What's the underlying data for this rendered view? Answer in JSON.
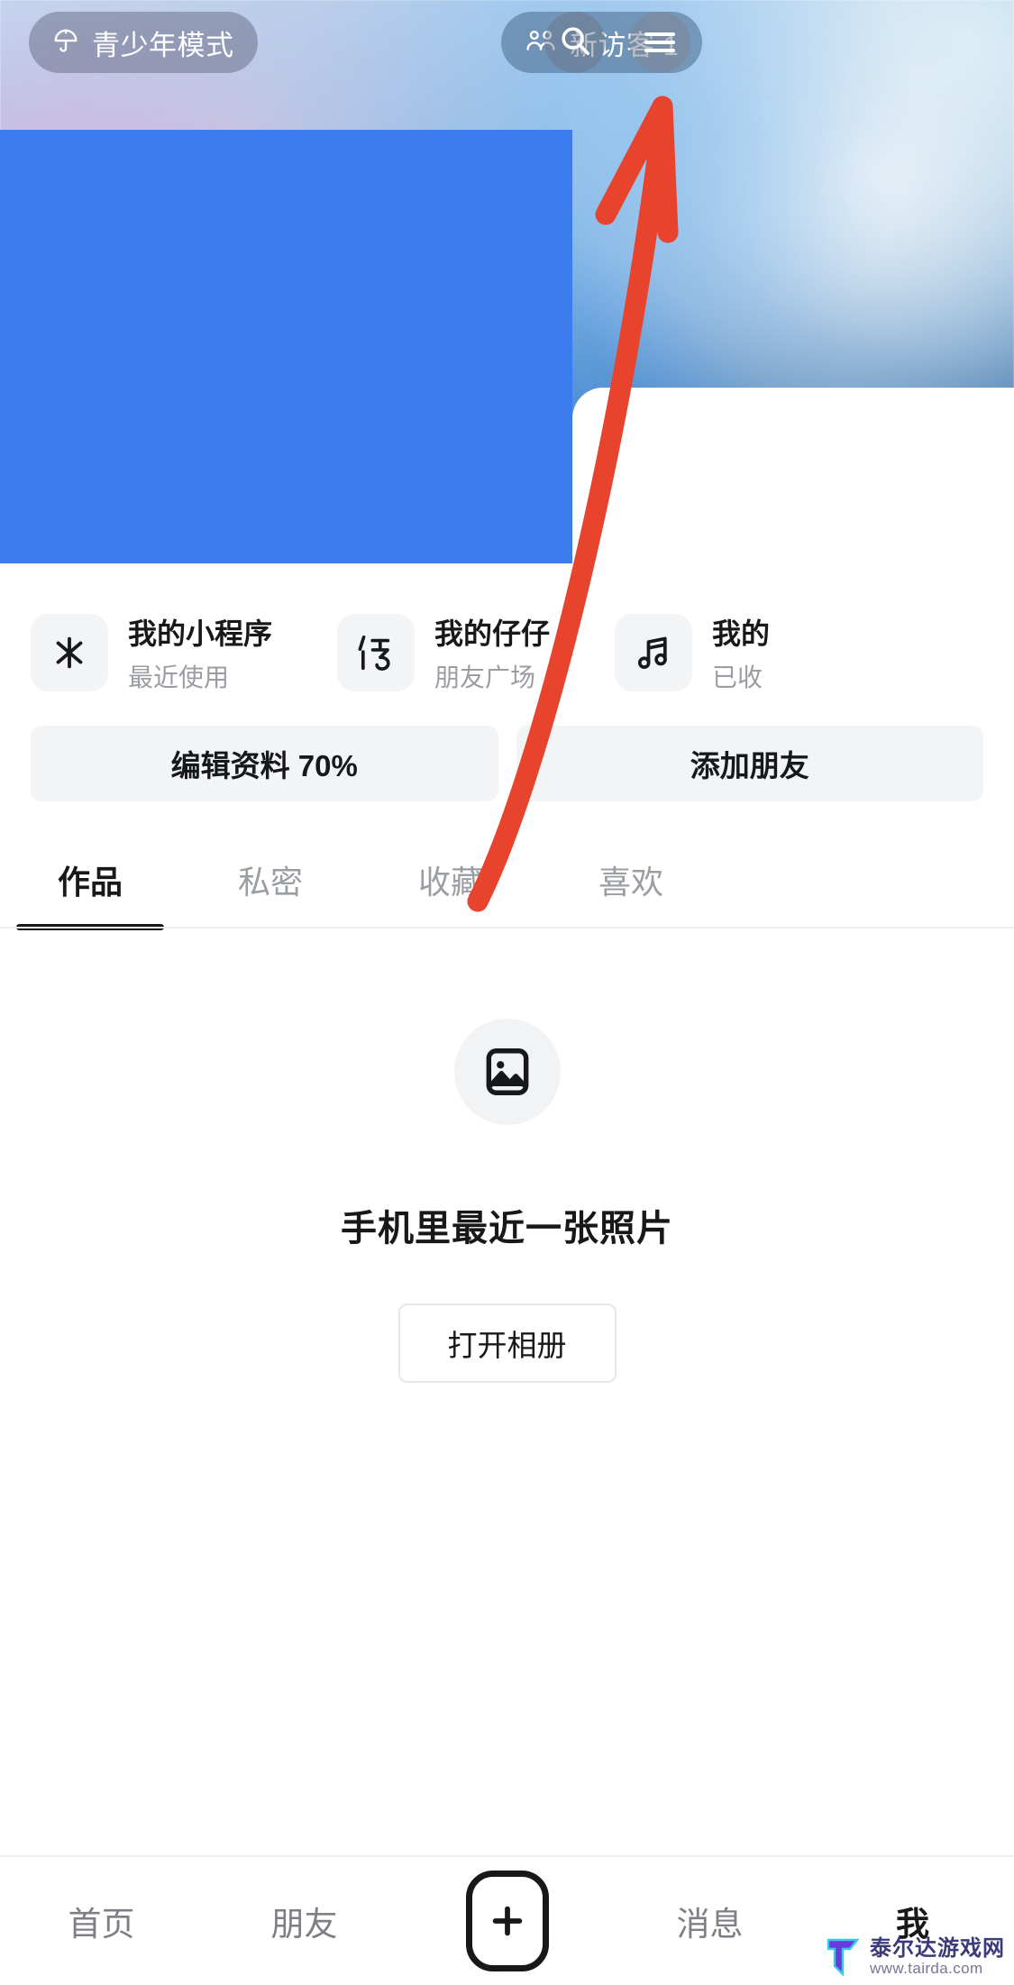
{
  "header": {
    "teen_mode": {
      "label": "青少年模式",
      "icon": "umbrella-icon"
    },
    "visitor": {
      "label": "新访客 1",
      "icon": "people-icon"
    },
    "search": {
      "icon": "search-icon"
    },
    "menu": {
      "icon": "hamburger-menu-icon"
    }
  },
  "mini_programs": [
    {
      "icon": "sparkle-icon",
      "title": "我的小程序",
      "subtitle": "最近使用"
    },
    {
      "icon": "character-zai-icon",
      "title": "我的仔仔",
      "subtitle": "朋友广场"
    },
    {
      "icon": "music-note-icon",
      "title": "我的",
      "subtitle": "已收"
    }
  ],
  "actions": [
    {
      "label": "编辑资料 70%"
    },
    {
      "label": "添加朋友"
    }
  ],
  "tabs": [
    {
      "label": "作品",
      "active": true
    },
    {
      "label": "私密",
      "active": false
    },
    {
      "label": "收藏",
      "active": false
    },
    {
      "label": "喜欢",
      "active": false
    }
  ],
  "empty_state": {
    "icon": "photo-icon",
    "text": "手机里最近一张照片",
    "button_label": "打开相册"
  },
  "bottom_nav": [
    {
      "label": "首页",
      "active": false
    },
    {
      "label": "朋友",
      "active": false
    },
    {
      "label": "",
      "icon": "plus-icon",
      "active": false
    },
    {
      "label": "消息",
      "active": false
    },
    {
      "label": "我",
      "active": true
    }
  ],
  "watermark": {
    "name": "泰尔达游戏网",
    "url": "www.tairda.com"
  },
  "colors": {
    "redaction_blue": "#3B7DEE",
    "annotation_red": "#E8432C",
    "text_primary": "#17181A",
    "text_secondary": "#9A9DA2",
    "chip_bg": "#F3F4F5"
  }
}
